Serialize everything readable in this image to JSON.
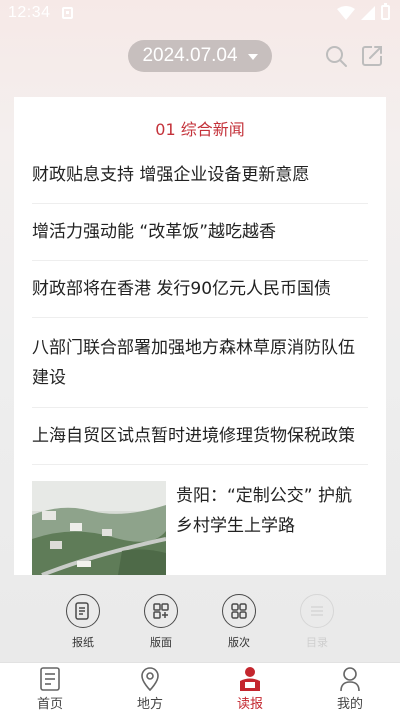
{
  "status_bar": {
    "time": "12:34",
    "icons": [
      "notification-icon",
      "wifi-icon",
      "signal-icon",
      "battery-icon"
    ]
  },
  "header": {
    "date": "2024.07.04",
    "icons": [
      "search-icon",
      "share-icon"
    ]
  },
  "section": {
    "title": "01 综合新闻",
    "items": [
      {
        "title": "财政贴息支持 增强企业设备更新意愿"
      },
      {
        "title": "增活力强动能 “改革饭”越吃越香"
      },
      {
        "title": "财政部将在香港 发行90亿元人民币国债"
      },
      {
        "title": "八部门联合部署加强地方森林草原消防队伍建设"
      },
      {
        "title": "上海自贸区试点暂时进境修理货物保税政策"
      }
    ],
    "image_item": {
      "title": "贵阳：“定制公交” 护航乡村学生上学路"
    }
  },
  "tools": [
    {
      "label": "报纸",
      "icon": "newspaper-icon"
    },
    {
      "label": "版面",
      "icon": "layout-icon"
    },
    {
      "label": "版次",
      "icon": "grid-icon"
    },
    {
      "label": "目录",
      "icon": "list-icon"
    }
  ],
  "tabs": [
    {
      "label": "首页",
      "icon": "home-doc-icon",
      "active": false
    },
    {
      "label": "地方",
      "icon": "location-icon",
      "active": false
    },
    {
      "label": "读报",
      "icon": "read-paper-icon",
      "active": true
    },
    {
      "label": "我的",
      "icon": "user-icon",
      "active": false
    }
  ],
  "colors": {
    "accent": "#c4262e",
    "pill": "#c7bfbe",
    "card": "#ffffff"
  }
}
